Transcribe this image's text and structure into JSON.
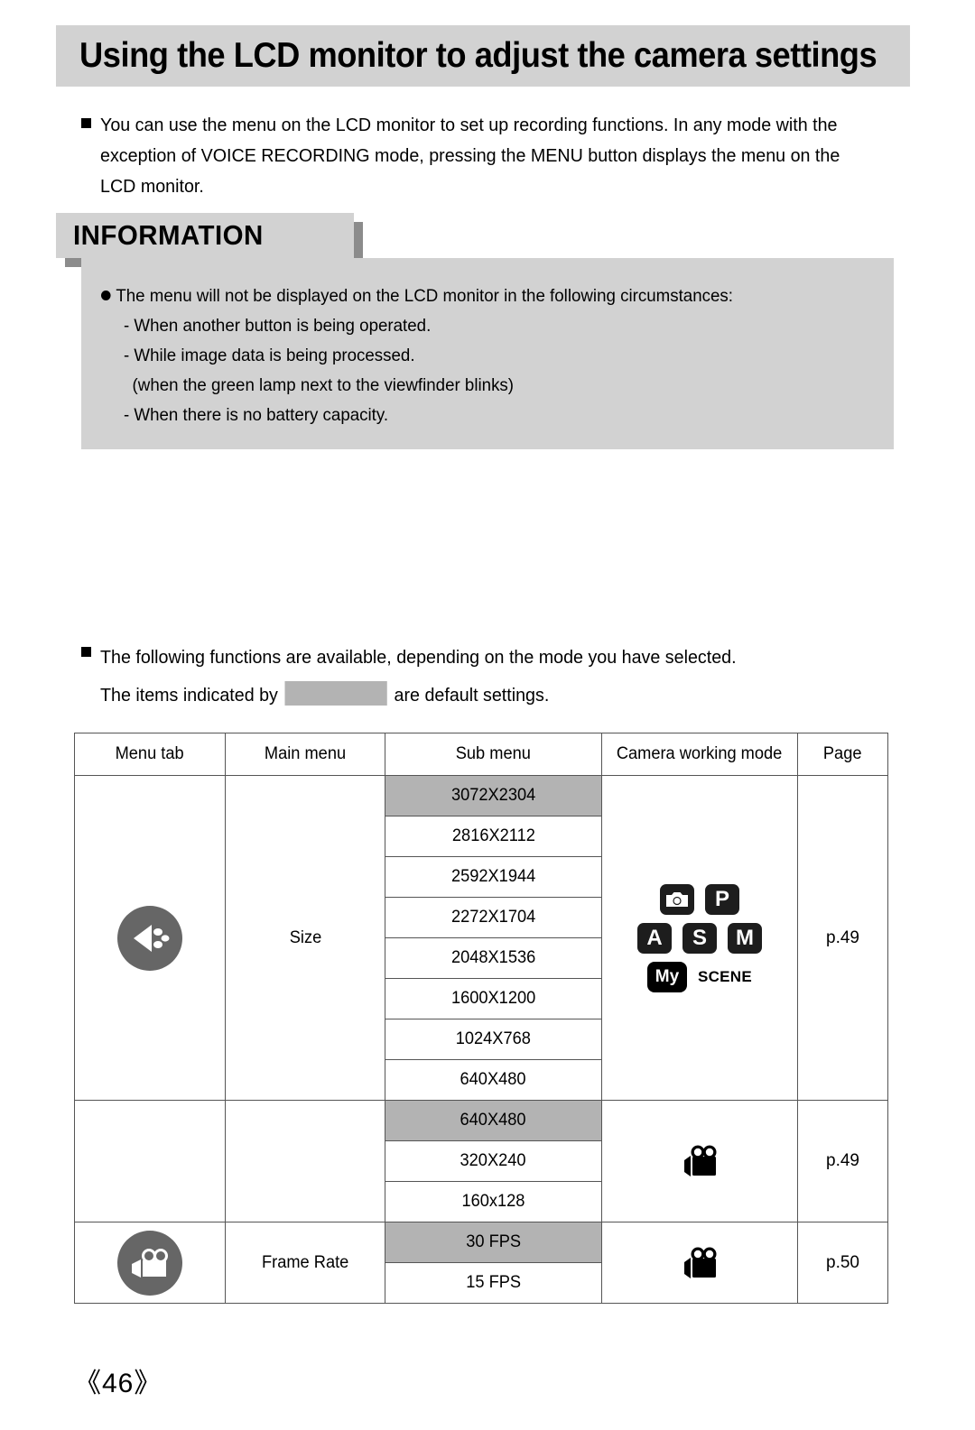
{
  "page": {
    "title": "Using the LCD monitor to adjust the camera settings",
    "footer_page_number": "《46》"
  },
  "intro": {
    "paragraph": "You can use the menu on the LCD monitor to set up recording functions. In any mode with the exception of VOICE RECORDING mode, pressing the MENU button displays the menu on the LCD monitor."
  },
  "information": {
    "header": "INFORMATION",
    "lines": [
      {
        "indent": 0,
        "bullet": "dot",
        "text": "The menu will not be displayed on the LCD monitor in the following circumstances:"
      },
      {
        "indent": 1,
        "bullet": "dash",
        "text": "- When another button is being operated."
      },
      {
        "indent": 1,
        "bullet": "dash",
        "text": "- While image data is being processed."
      },
      {
        "indent": 2,
        "bullet": "none",
        "text": "(when the green lamp next to the viewfinder blinks)"
      },
      {
        "indent": 1,
        "bullet": "dash",
        "text": "- When there is no battery capacity."
      }
    ]
  },
  "note": {
    "line1": "The following functions are available, depending on the mode you have selected.",
    "line2_before": "The items indicated by",
    "line2_after": "are default settings.",
    "swatch_color": "#b3b3b3"
  },
  "table": {
    "headers": [
      "Menu tab",
      "Main menu",
      "Sub menu",
      "Camera working mode",
      "Page"
    ],
    "groups": [
      {
        "tab_icon": "size-resolution-icon",
        "main_menu": "Size",
        "page": "p.49",
        "mode_icons": [
          "camera-icon",
          "P",
          "A",
          "S",
          "M",
          "My",
          "SCENE"
        ],
        "sub_menu": [
          {
            "value": "3072X2304",
            "default": true
          },
          {
            "value": "2816X2112",
            "default": false
          },
          {
            "value": "2592X1944",
            "default": false
          },
          {
            "value": "2272X1704",
            "default": false
          },
          {
            "value": "2048X1536",
            "default": false
          },
          {
            "value": "1600X1200",
            "default": false
          },
          {
            "value": "1024X768",
            "default": false
          },
          {
            "value": "640X480",
            "default": false
          }
        ]
      },
      {
        "tab_icon": "",
        "main_menu": "",
        "page": "p.49",
        "mode_icons": [
          "movie-camera-icon"
        ],
        "sub_menu": [
          {
            "value": "640X480",
            "default": true
          },
          {
            "value": "320X240",
            "default": false
          },
          {
            "value": "160x128",
            "default": false
          }
        ]
      },
      {
        "tab_icon": "movie-camera-icon",
        "main_menu": "Frame Rate",
        "page": "p.50",
        "mode_icons": [
          "movie-camera-icon"
        ],
        "sub_menu": [
          {
            "value": "30 FPS",
            "default": true
          },
          {
            "value": "15 FPS",
            "default": false
          }
        ]
      }
    ]
  },
  "colors": {
    "band_gray": "#d2d2d2",
    "highlight_gray": "#b3b3b3",
    "icon_circle_gray": "#666666",
    "shadow_gray": "#8c8c8c"
  }
}
